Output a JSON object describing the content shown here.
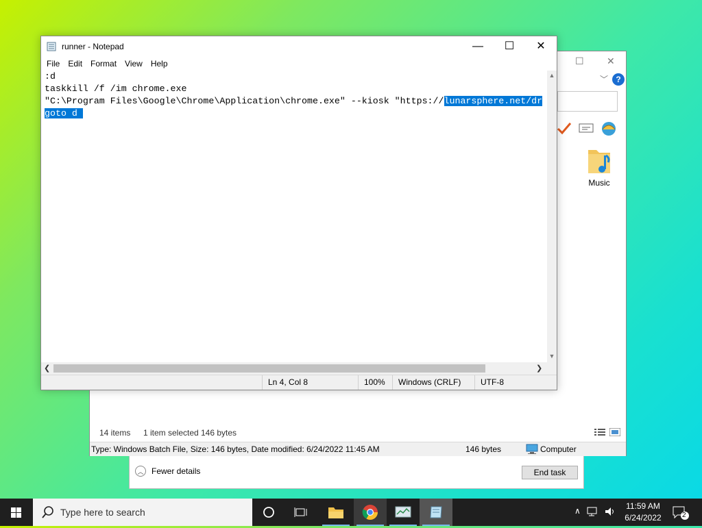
{
  "notepad": {
    "title": "runner - Notepad",
    "menu": [
      "File",
      "Edit",
      "Format",
      "View",
      "Help"
    ],
    "lines": [
      {
        "plain": ":d",
        "selected": ""
      },
      {
        "plain": "taskkill /f /im chrome.exe",
        "selected": ""
      },
      {
        "plain": "\"C:\\Program Files\\Google\\Chrome\\Application\\chrome.exe\" --kiosk \"https://",
        "selected": "lunarsphere.net/dr"
      },
      {
        "plain": "",
        "selected": "goto d "
      }
    ],
    "status": {
      "position": "Ln 4, Col 8",
      "zoom": "100%",
      "line_ending": "Windows (CRLF)",
      "encoding": "UTF-8"
    }
  },
  "explorer": {
    "music_label": "Music",
    "items_count": "14 items",
    "selection": "1 item selected",
    "selection_size": "146 bytes",
    "details": "Type: Windows Batch File, Size: 146 bytes, Date modified: 6/24/2022 11:45 AM",
    "details_size": "146 bytes",
    "details_location": "Computer",
    "help_glyph": "?"
  },
  "taskmgr": {
    "fewer_details": "Fewer details",
    "end_task": "End task"
  },
  "taskbar": {
    "search_placeholder": "Type here to search",
    "time": "11:59 AM",
    "date": "6/24/2022",
    "notification_count": "2"
  },
  "colors": {
    "selection": "#0078d7",
    "taskbar": "#1f1f1f",
    "help_blue": "#1a6dd1"
  }
}
